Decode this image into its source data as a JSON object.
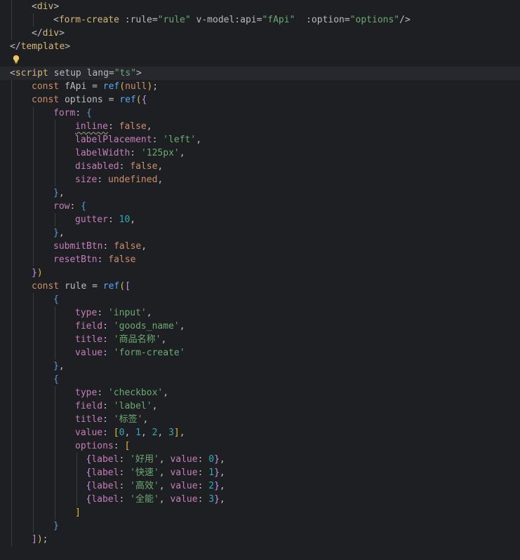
{
  "colors": {
    "background": "#1e1f22",
    "current_line": "#26282e",
    "tag": "#d5b778",
    "attribute": "#bababa",
    "string": "#6aab73",
    "keyword": "#cf8e6d",
    "function": "#56a8f5",
    "property": "#c77dbb",
    "number": "#2aacb8",
    "text": "#bcbec4"
  },
  "icons": {
    "intention": "lightbulb-icon"
  },
  "highlighted_line": 5,
  "lines": [
    {
      "indent": 1,
      "tokens": [
        [
          "tagbr",
          "<"
        ],
        [
          "tag",
          "div"
        ],
        [
          "tagbr",
          ">"
        ]
      ]
    },
    {
      "indent": 2,
      "tokens": [
        [
          "tagbr",
          "<"
        ],
        [
          "tag",
          "form-create"
        ],
        [
          "punc",
          " "
        ],
        [
          "attr",
          ":rule"
        ],
        [
          "punc",
          "="
        ],
        [
          "str",
          "\"rule\""
        ],
        [
          "punc",
          " "
        ],
        [
          "attr",
          "v-model:api"
        ],
        [
          "punc",
          "="
        ],
        [
          "str",
          "\"fApi\""
        ],
        [
          "punc",
          "  "
        ],
        [
          "attr",
          ":option"
        ],
        [
          "punc",
          "="
        ],
        [
          "str",
          "\"options\""
        ],
        [
          "tagbr",
          "/>"
        ]
      ]
    },
    {
      "indent": 1,
      "tokens": [
        [
          "tagbr",
          "</"
        ],
        [
          "tag",
          "div"
        ],
        [
          "tagbr",
          ">"
        ]
      ]
    },
    {
      "indent": 0,
      "tokens": [
        [
          "tagbr",
          "</"
        ],
        [
          "tag",
          "template"
        ],
        [
          "tagbr",
          ">"
        ]
      ]
    },
    {
      "indent": 0,
      "tokens": []
    },
    {
      "indent": 0,
      "tokens": [
        [
          "tagbr",
          "<"
        ],
        [
          "tag",
          "script"
        ],
        [
          "punc",
          " "
        ],
        [
          "attr",
          "setup"
        ],
        [
          "punc",
          " "
        ],
        [
          "attr",
          "lang"
        ],
        [
          "punc",
          "="
        ],
        [
          "str",
          "\"ts\""
        ],
        [
          "tagbr",
          ">"
        ]
      ]
    },
    {
      "indent": 1,
      "tokens": [
        [
          "kw",
          "const"
        ],
        [
          "punc",
          " "
        ],
        [
          "var",
          "fApi"
        ],
        [
          "punc",
          " = "
        ],
        [
          "fn",
          "ref"
        ],
        [
          "b1",
          "("
        ],
        [
          "kw",
          "null"
        ],
        [
          "b1",
          ")"
        ],
        [
          "punc",
          ";"
        ]
      ]
    },
    {
      "indent": 1,
      "tokens": [
        [
          "kw",
          "const"
        ],
        [
          "punc",
          " "
        ],
        [
          "var",
          "options"
        ],
        [
          "punc",
          " = "
        ],
        [
          "fn",
          "ref"
        ],
        [
          "b1",
          "("
        ],
        [
          "b2",
          "{"
        ]
      ]
    },
    {
      "indent": 2,
      "tokens": [
        [
          "prop",
          "form"
        ],
        [
          "punc",
          ": "
        ],
        [
          "b3",
          "{"
        ]
      ]
    },
    {
      "indent": 3,
      "tokens": [
        [
          "proptypo",
          "inline"
        ],
        [
          "punc",
          ": "
        ],
        [
          "kw",
          "false"
        ],
        [
          "punc",
          ","
        ]
      ]
    },
    {
      "indent": 3,
      "tokens": [
        [
          "prop",
          "labelPlacement"
        ],
        [
          "punc",
          ": "
        ],
        [
          "str",
          "'left'"
        ],
        [
          "punc",
          ","
        ]
      ]
    },
    {
      "indent": 3,
      "tokens": [
        [
          "prop",
          "labelWidth"
        ],
        [
          "punc",
          ": "
        ],
        [
          "str",
          "'125px'"
        ],
        [
          "punc",
          ","
        ]
      ]
    },
    {
      "indent": 3,
      "tokens": [
        [
          "prop",
          "disabled"
        ],
        [
          "punc",
          ": "
        ],
        [
          "kw",
          "false"
        ],
        [
          "punc",
          ","
        ]
      ]
    },
    {
      "indent": 3,
      "tokens": [
        [
          "prop",
          "size"
        ],
        [
          "punc",
          ": "
        ],
        [
          "kw",
          "undefined"
        ],
        [
          "punc",
          ","
        ]
      ]
    },
    {
      "indent": 2,
      "tokens": [
        [
          "b3",
          "}"
        ],
        [
          "punc",
          ","
        ]
      ]
    },
    {
      "indent": 2,
      "tokens": [
        [
          "prop",
          "row"
        ],
        [
          "punc",
          ": "
        ],
        [
          "b3",
          "{"
        ]
      ]
    },
    {
      "indent": 3,
      "tokens": [
        [
          "prop",
          "gutter"
        ],
        [
          "punc",
          ": "
        ],
        [
          "num",
          "10"
        ],
        [
          "punc",
          ","
        ]
      ]
    },
    {
      "indent": 2,
      "tokens": [
        [
          "b3",
          "}"
        ],
        [
          "punc",
          ","
        ]
      ]
    },
    {
      "indent": 2,
      "tokens": [
        [
          "prop",
          "submitBtn"
        ],
        [
          "punc",
          ": "
        ],
        [
          "kw",
          "false"
        ],
        [
          "punc",
          ","
        ]
      ]
    },
    {
      "indent": 2,
      "tokens": [
        [
          "prop",
          "resetBtn"
        ],
        [
          "punc",
          ": "
        ],
        [
          "kw",
          "false"
        ]
      ]
    },
    {
      "indent": 1,
      "tokens": [
        [
          "b2",
          "}"
        ],
        [
          "b1",
          ")"
        ]
      ]
    },
    {
      "indent": 1,
      "tokens": [
        [
          "kw",
          "const"
        ],
        [
          "punc",
          " "
        ],
        [
          "var",
          "rule"
        ],
        [
          "punc",
          " = "
        ],
        [
          "fn",
          "ref"
        ],
        [
          "b1",
          "("
        ],
        [
          "b2",
          "["
        ]
      ]
    },
    {
      "indent": 2,
      "tokens": [
        [
          "b3",
          "{"
        ]
      ]
    },
    {
      "indent": 3,
      "tokens": [
        [
          "prop",
          "type"
        ],
        [
          "punc",
          ": "
        ],
        [
          "str",
          "'input'"
        ],
        [
          "punc",
          ","
        ]
      ]
    },
    {
      "indent": 3,
      "tokens": [
        [
          "prop",
          "field"
        ],
        [
          "punc",
          ": "
        ],
        [
          "str",
          "'goods_name'"
        ],
        [
          "punc",
          ","
        ]
      ]
    },
    {
      "indent": 3,
      "tokens": [
        [
          "prop",
          "title"
        ],
        [
          "punc",
          ": "
        ],
        [
          "str",
          "'商品名称'"
        ],
        [
          "punc",
          ","
        ]
      ]
    },
    {
      "indent": 3,
      "tokens": [
        [
          "prop",
          "value"
        ],
        [
          "punc",
          ": "
        ],
        [
          "str",
          "'form-create'"
        ]
      ]
    },
    {
      "indent": 2,
      "tokens": [
        [
          "b3",
          "}"
        ],
        [
          "punc",
          ","
        ]
      ]
    },
    {
      "indent": 2,
      "tokens": [
        [
          "b3",
          "{"
        ]
      ]
    },
    {
      "indent": 3,
      "tokens": [
        [
          "prop",
          "type"
        ],
        [
          "punc",
          ": "
        ],
        [
          "str",
          "'checkbox'"
        ],
        [
          "punc",
          ","
        ]
      ]
    },
    {
      "indent": 3,
      "tokens": [
        [
          "prop",
          "field"
        ],
        [
          "punc",
          ": "
        ],
        [
          "str",
          "'label'"
        ],
        [
          "punc",
          ","
        ]
      ]
    },
    {
      "indent": 3,
      "tokens": [
        [
          "prop",
          "title"
        ],
        [
          "punc",
          ": "
        ],
        [
          "str",
          "'标签'"
        ],
        [
          "punc",
          ","
        ]
      ]
    },
    {
      "indent": 3,
      "tokens": [
        [
          "prop",
          "value"
        ],
        [
          "punc",
          ": "
        ],
        [
          "b1",
          "["
        ],
        [
          "num",
          "0"
        ],
        [
          "punc",
          ", "
        ],
        [
          "num",
          "1"
        ],
        [
          "punc",
          ", "
        ],
        [
          "num",
          "2"
        ],
        [
          "punc",
          ", "
        ],
        [
          "num",
          "3"
        ],
        [
          "b1",
          "]"
        ],
        [
          "punc",
          ","
        ]
      ]
    },
    {
      "indent": 3,
      "tokens": [
        [
          "prop",
          "options"
        ],
        [
          "punc",
          ": "
        ],
        [
          "b1",
          "["
        ]
      ]
    },
    {
      "indent": 3.5,
      "tokens": [
        [
          "b2",
          "{"
        ],
        [
          "prop",
          "label"
        ],
        [
          "punc",
          ": "
        ],
        [
          "str",
          "'好用'"
        ],
        [
          "punc",
          ", "
        ],
        [
          "prop",
          "value"
        ],
        [
          "punc",
          ": "
        ],
        [
          "num",
          "0"
        ],
        [
          "b2",
          "}"
        ],
        [
          "punc",
          ","
        ]
      ]
    },
    {
      "indent": 3.5,
      "tokens": [
        [
          "b2",
          "{"
        ],
        [
          "prop",
          "label"
        ],
        [
          "punc",
          ": "
        ],
        [
          "str",
          "'快速'"
        ],
        [
          "punc",
          ", "
        ],
        [
          "prop",
          "value"
        ],
        [
          "punc",
          ": "
        ],
        [
          "num",
          "1"
        ],
        [
          "b2",
          "}"
        ],
        [
          "punc",
          ","
        ]
      ]
    },
    {
      "indent": 3.5,
      "tokens": [
        [
          "b2",
          "{"
        ],
        [
          "prop",
          "label"
        ],
        [
          "punc",
          ": "
        ],
        [
          "str",
          "'高效'"
        ],
        [
          "punc",
          ", "
        ],
        [
          "prop",
          "value"
        ],
        [
          "punc",
          ": "
        ],
        [
          "num",
          "2"
        ],
        [
          "b2",
          "}"
        ],
        [
          "punc",
          ","
        ]
      ]
    },
    {
      "indent": 3.5,
      "tokens": [
        [
          "b2",
          "{"
        ],
        [
          "prop",
          "label"
        ],
        [
          "punc",
          ": "
        ],
        [
          "str",
          "'全能'"
        ],
        [
          "punc",
          ", "
        ],
        [
          "prop",
          "value"
        ],
        [
          "punc",
          ": "
        ],
        [
          "num",
          "3"
        ],
        [
          "b2",
          "}"
        ],
        [
          "punc",
          ","
        ]
      ]
    },
    {
      "indent": 3,
      "tokens": [
        [
          "b1",
          "]"
        ]
      ]
    },
    {
      "indent": 2,
      "tokens": [
        [
          "b3",
          "}"
        ]
      ]
    },
    {
      "indent": 1,
      "tokens": [
        [
          "b2",
          "]"
        ],
        [
          "b1",
          ")"
        ],
        [
          "punc",
          ";"
        ]
      ]
    }
  ]
}
